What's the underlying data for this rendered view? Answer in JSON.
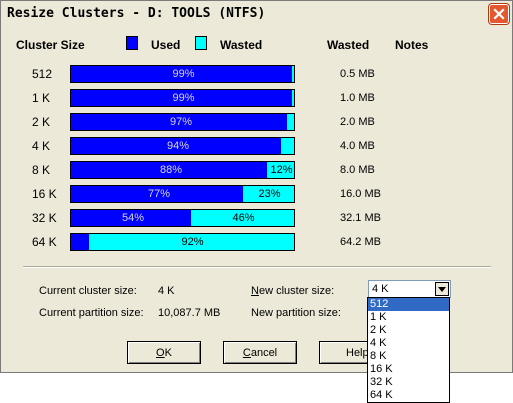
{
  "window": {
    "title": "Resize Clusters - D: TOOLS (NTFS)",
    "close_icon": "close-icon"
  },
  "colors": {
    "used": "#0000ff",
    "wasted": "#00ffff",
    "dialog_bg": "#ece9d8",
    "selection": "#316ac5"
  },
  "table": {
    "headers": {
      "cluster_size": "Cluster Size",
      "used": "Used",
      "wasted": "Wasted",
      "wasted_col": "Wasted",
      "notes": "Notes"
    },
    "rows": [
      {
        "size": "512",
        "used_label": "99%",
        "wasted_label": "",
        "used_fraction": 0.99,
        "wasted": "0.5 MB"
      },
      {
        "size": "1 K",
        "used_label": "99%",
        "wasted_label": "",
        "used_fraction": 0.99,
        "wasted": "1.0 MB"
      },
      {
        "size": "2 K",
        "used_label": "97%",
        "wasted_label": "",
        "used_fraction": 0.97,
        "wasted": "2.0 MB"
      },
      {
        "size": "4 K",
        "used_label": "94%",
        "wasted_label": "",
        "used_fraction": 0.94,
        "wasted": "4.0 MB"
      },
      {
        "size": "8 K",
        "used_label": "88%",
        "wasted_label": "12%",
        "used_fraction": 0.88,
        "wasted": "8.0 MB"
      },
      {
        "size": "16 K",
        "used_label": "77%",
        "wasted_label": "23%",
        "used_fraction": 0.77,
        "wasted": "16.0 MB"
      },
      {
        "size": "32 K",
        "used_label": "54%",
        "wasted_label": "46%",
        "used_fraction": 0.54,
        "wasted": "32.1 MB"
      },
      {
        "size": "64 K",
        "used_label": "",
        "wasted_label": "92%",
        "used_fraction": 0.08,
        "wasted": "64.2 MB"
      }
    ]
  },
  "info": {
    "current_cluster_label": "Current cluster size:",
    "current_cluster_value": "4 K",
    "current_partition_label": "Current partition size:",
    "current_partition_value": "10,087.7 MB",
    "new_cluster_label_u": "N",
    "new_cluster_label_rest": "ew cluster size:",
    "new_partition_label": "New partition size:"
  },
  "new_cluster_select": {
    "value": "4 K",
    "options": [
      "512",
      "1 K",
      "2 K",
      "4 K",
      "8 K",
      "16 K",
      "32 K",
      "64 K"
    ],
    "highlighted": "512"
  },
  "buttons": {
    "ok_u": "O",
    "ok_rest": "K",
    "cancel_u": "C",
    "cancel_rest": "ancel",
    "help": "Help"
  }
}
